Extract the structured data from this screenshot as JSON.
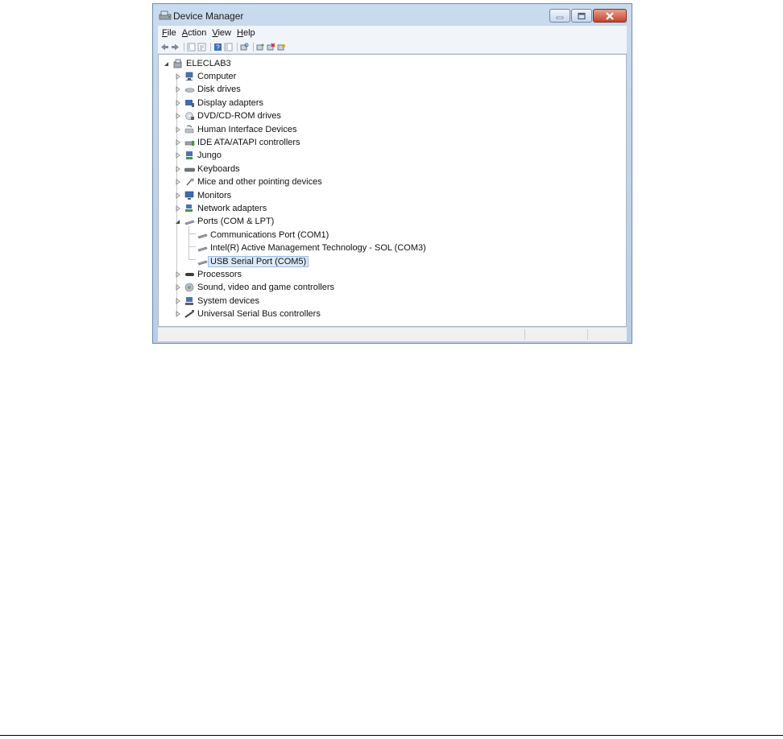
{
  "window": {
    "title": "Device Manager",
    "icon": "device-manager-icon",
    "controls": [
      "minimize-icon",
      "maximize-icon",
      "close-icon"
    ]
  },
  "menu": {
    "items": [
      {
        "key": "F",
        "rest": "ile"
      },
      {
        "key": "A",
        "rest": "ction"
      },
      {
        "key": "V",
        "rest": "iew"
      },
      {
        "key": "H",
        "rest": "elp"
      }
    ]
  },
  "toolbar": {
    "icons": [
      "back-arrow-icon",
      "forward-arrow-icon",
      "show-hide-tree-icon",
      "properties-icon",
      "help-icon",
      "view-icon",
      "scan-hardware-icon",
      "update-driver-icon",
      "uninstall-icon",
      "disable-icon"
    ]
  },
  "tree": {
    "root": "ELECLAB3",
    "categories": [
      {
        "label": "Computer",
        "icon": "computer-icon"
      },
      {
        "label": "Disk drives",
        "icon": "disk-drive-icon"
      },
      {
        "label": "Display adapters",
        "icon": "display-adapter-icon"
      },
      {
        "label": "DVD/CD-ROM drives",
        "icon": "dvd-drive-icon"
      },
      {
        "label": "Human Interface Devices",
        "icon": "hid-icon"
      },
      {
        "label": "IDE ATA/ATAPI controllers",
        "icon": "ide-controller-icon"
      },
      {
        "label": "Jungo",
        "icon": "jungo-icon"
      },
      {
        "label": "Keyboards",
        "icon": "keyboard-icon"
      },
      {
        "label": "Mice and other pointing devices",
        "icon": "mouse-icon"
      },
      {
        "label": "Monitors",
        "icon": "monitor-icon"
      },
      {
        "label": "Network adapters",
        "icon": "network-adapter-icon"
      },
      {
        "label": "Ports (COM & LPT)",
        "icon": "port-icon",
        "expanded": true
      },
      {
        "label": "Processors",
        "icon": "processor-icon"
      },
      {
        "label": "Sound, video and game controllers",
        "icon": "sound-icon"
      },
      {
        "label": "System devices",
        "icon": "system-devices-icon"
      },
      {
        "label": "Universal Serial Bus controllers",
        "icon": "usb-icon"
      }
    ],
    "ports": [
      {
        "label": "Communications Port (COM1)",
        "icon": "port-icon"
      },
      {
        "label": "Intel(R) Active Management Technology - SOL (COM3)",
        "icon": "port-icon"
      },
      {
        "label": "USB Serial Port (COM5)",
        "icon": "port-icon",
        "selected": true
      }
    ]
  },
  "colors": {
    "frame": "#c9dbee",
    "close_button": "#c5432c",
    "selection": "#dbe8f6"
  }
}
